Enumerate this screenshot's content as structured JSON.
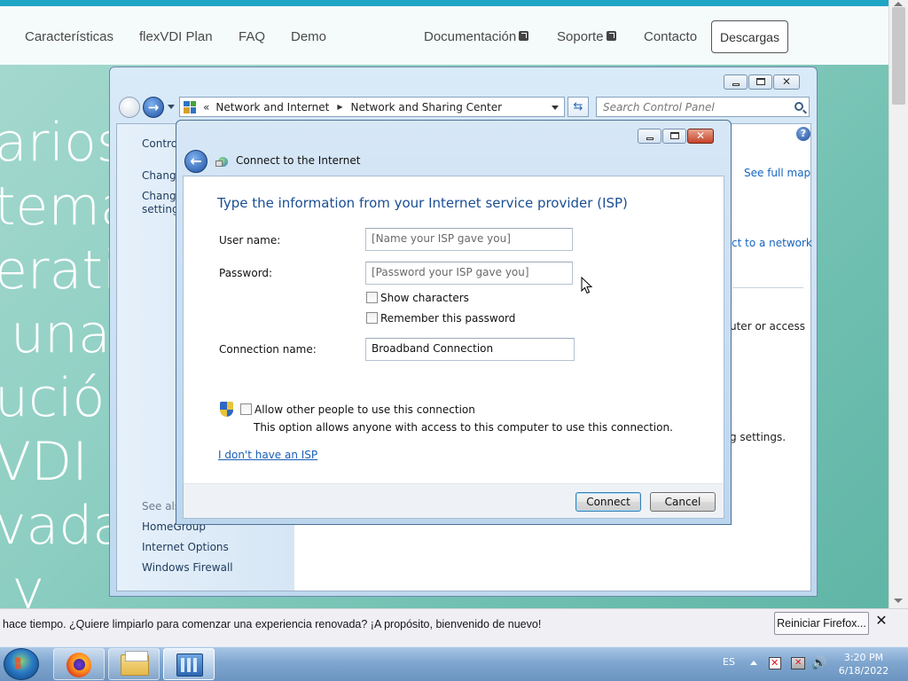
{
  "website": {
    "nav": [
      "Características",
      "flexVDI Plan",
      "FAQ",
      "Demo",
      "Documentación",
      "Soporte",
      "Contacto"
    ],
    "download_button": "Descargas",
    "hero_lines": [
      "arios",
      "tema",
      "erati",
      "una",
      "ució",
      "VDI",
      "vada",
      "y"
    ]
  },
  "control_panel": {
    "address": {
      "chevrons": "«",
      "crumb1": "Network and Internet",
      "crumb2": "Network and Sharing Center"
    },
    "search_placeholder": "Search Control Panel",
    "left": {
      "item1": "Control",
      "item2": "Change",
      "item3a": "Change",
      "item3b": "settings",
      "see_also": "See also",
      "links": [
        "HomeGroup",
        "Internet Options",
        "Windows Firewall"
      ]
    },
    "right": {
      "see_full_map": "See full map",
      "connect_network": "ct to a network",
      "access_text": "uter or access",
      "settings_text": "g settings."
    }
  },
  "dialog": {
    "title": "Connect to the Internet",
    "heading": "Type the information from your Internet service provider (ISP)",
    "user_name_label": "User name:",
    "user_name_placeholder": "[Name your ISP gave you]",
    "password_label": "Password:",
    "password_placeholder": "[Password your ISP gave you]",
    "show_characters": "Show characters",
    "remember_password": "Remember this password",
    "connection_name_label": "Connection name:",
    "connection_name_value": "Broadband Connection",
    "allow_others": "Allow other people to use this connection",
    "allow_note": "This option allows anyone with access to this computer to use this connection.",
    "no_isp_link": "I don't have an ISP",
    "connect_button": "Connect",
    "cancel_button": "Cancel"
  },
  "firefox_bar": {
    "message": "hace tiempo. ¿Quiere limpiarlo para comenzar una experiencia renovada? ¡A propósito, bienvenido de nuevo!",
    "button": "Reiniciar Firefox...",
    "close": "✕"
  },
  "taskbar": {
    "language": "ES",
    "time": "3:20 PM",
    "date": "6/18/2022"
  }
}
